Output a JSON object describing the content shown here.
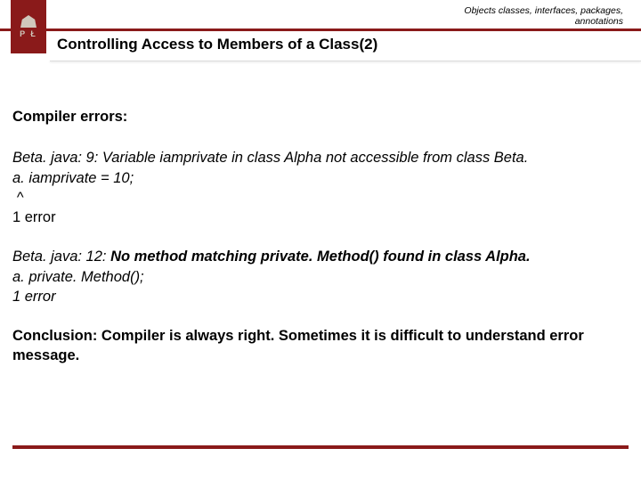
{
  "header": {
    "breadcrumb_line1": "Objects classes, interfaces, packages,",
    "breadcrumb_line2": "annotations",
    "logo_letters": "P Ł",
    "title": "Controlling Access to Members of a Class(2)"
  },
  "body": {
    "heading": "Compiler errors:",
    "error1": {
      "line1": "Beta. java: 9: Variable iamprivate in class Alpha not accessible from class Beta.",
      "line2": "a. iamprivate = 10;",
      "caret": " ^",
      "summary": "1 error"
    },
    "error2": {
      "line1_prefix": "Beta. java: 12: ",
      "line1_bold": "No method matching private. Method() found in class Alpha.",
      "line2": "a. private. Method();",
      "summary": "1 error"
    },
    "conclusion": "Conclusion: Compiler is always right. Sometimes it is difficult to understand error message."
  }
}
